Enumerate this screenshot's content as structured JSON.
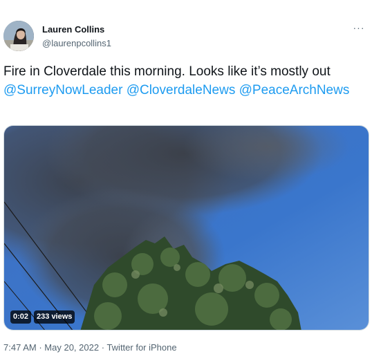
{
  "author": {
    "name": "Lauren Collins",
    "handle": "@laurenpcollins1",
    "avatar_icon": "profile-photo"
  },
  "tweet": {
    "text_plain": "Fire in Cloverdale this morning. Looks like it’s mostly out",
    "mentions": [
      "@SurreyNowLeader",
      "@CloverdaleNews",
      "@PeaceArchNews"
    ],
    "more_icon": "more-horizontal-icon"
  },
  "media": {
    "type": "video",
    "duration": "0:02",
    "views": "233 views"
  },
  "meta": {
    "time": "7:47 AM",
    "separator": "·",
    "date": "May 20, 2022",
    "source": "Twitter for iPhone"
  },
  "colors": {
    "link": "#1d9bf0",
    "secondary_text": "#536471",
    "primary_text": "#0f1419"
  }
}
